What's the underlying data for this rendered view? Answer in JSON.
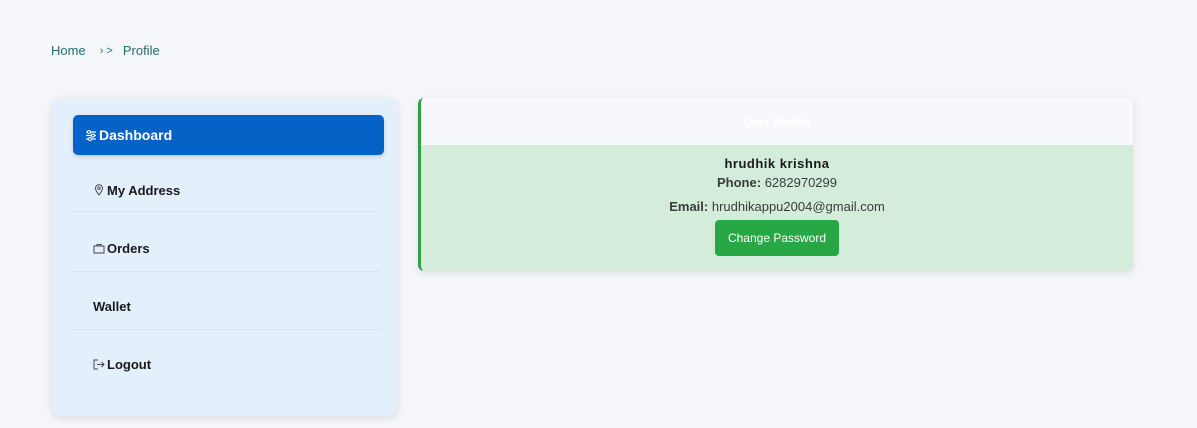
{
  "breadcrumb": {
    "home": "Home",
    "separator": "› >",
    "current": "Profile"
  },
  "sidebar": {
    "items": [
      {
        "label": "Dashboard",
        "icon": "sliders-icon",
        "active": true
      },
      {
        "label": "My Address",
        "icon": "location-pin-icon"
      },
      {
        "label": "Orders",
        "icon": "shopping-bag-icon"
      },
      {
        "label": "Wallet",
        "icon": ""
      },
      {
        "label": "Logout",
        "icon": "logout-icon"
      }
    ]
  },
  "profile": {
    "header": "User Profile",
    "name": "hrudhik krishna",
    "phone_label": "Phone:",
    "phone": "6282970299",
    "email_label": "Email:",
    "email": "hrudhikappu2004@gmail.com",
    "change_password_label": "Change Password"
  },
  "colors": {
    "accent_blue": "#0563c7",
    "accent_green": "#28a745",
    "card_bg": "#d4ecda",
    "sidebar_bg": "#e3f0fc"
  }
}
